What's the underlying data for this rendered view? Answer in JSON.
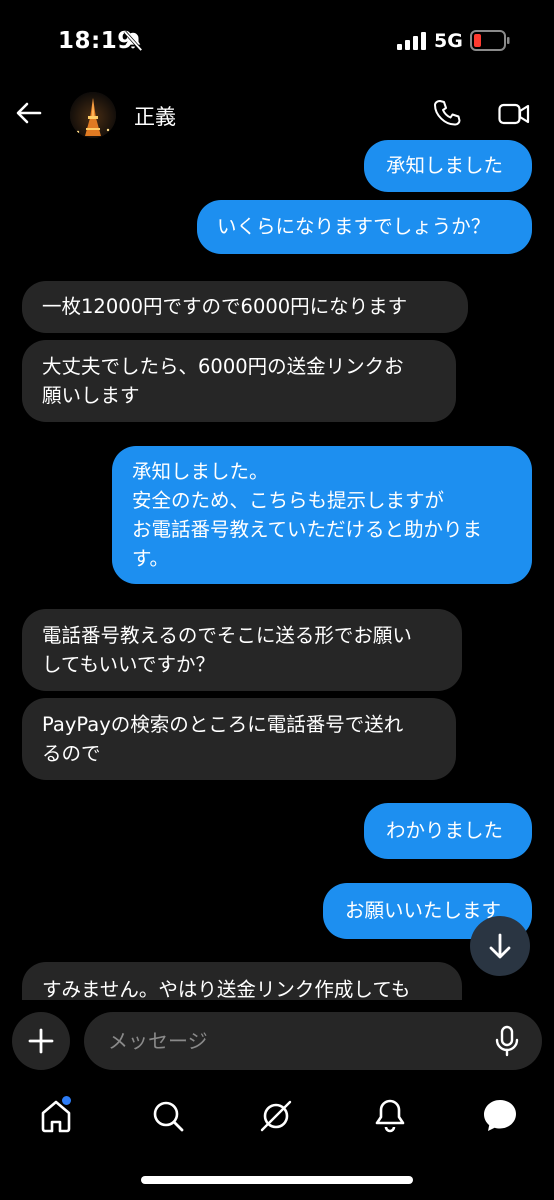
{
  "status_bar": {
    "time": "18:19",
    "network": "5G"
  },
  "header": {
    "contact_name": "正義"
  },
  "messages": [
    {
      "direction": "out",
      "lines": [
        "承知しました"
      ]
    },
    {
      "direction": "out",
      "lines": [
        "いくらになりますでしょうか？"
      ]
    },
    {
      "direction": "in",
      "lines": [
        "一枚12000円ですので6000円になります"
      ]
    },
    {
      "direction": "in",
      "lines": [
        "大丈夫でしたら、6000円の送金リンクお",
        "願いします"
      ]
    },
    {
      "direction": "out",
      "lines": [
        "承知しました。",
        "安全のため、こちらも提示しますが",
        "お電話番号教えていただけると助かりま",
        "す。"
      ]
    },
    {
      "direction": "in",
      "lines": [
        "電話番号教えるのでそこに送る形でお願い",
        "してもいいですか？"
      ]
    },
    {
      "direction": "in",
      "lines": [
        "PayPayの検索のところに電話番号で送れ",
        "るので"
      ]
    },
    {
      "direction": "out",
      "lines": [
        "わかりました"
      ]
    },
    {
      "direction": "out",
      "lines": [
        "お願いいたします"
      ]
    },
    {
      "direction": "in",
      "lines": [
        "すみません。やはり送金リンク作成しても"
      ]
    }
  ],
  "composer": {
    "placeholder": "メッセージ"
  },
  "colors": {
    "outgoing_bubble": "#1d8ff0",
    "incoming_bubble": "#262626",
    "background": "#000000",
    "notification_dot": "#2d7cf6"
  },
  "tabs": [
    {
      "icon": "home-icon",
      "active": true,
      "has_notification": true
    },
    {
      "icon": "search-icon"
    },
    {
      "icon": "explore-icon"
    },
    {
      "icon": "bell-icon"
    },
    {
      "icon": "chat-icon"
    }
  ]
}
